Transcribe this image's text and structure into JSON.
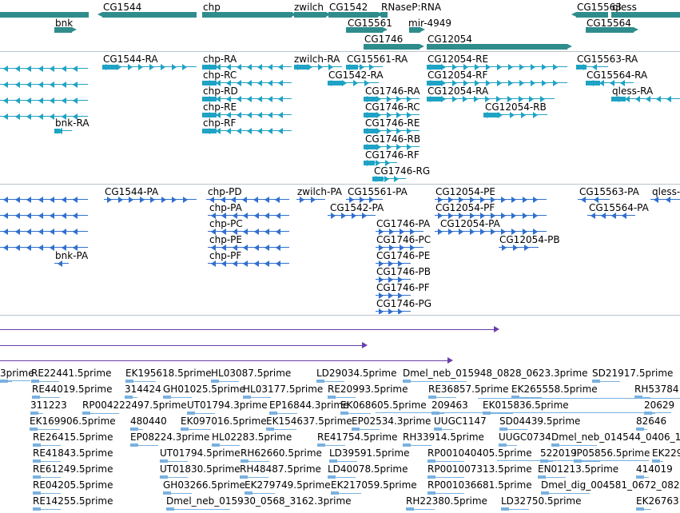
{
  "colors": {
    "gene": "#2f8c8c",
    "transcript": "#1ea3c4",
    "protein": "#2f6fd0",
    "purple": "#6a3fa8",
    "est": "#7ab1e0",
    "divider": "#b8c4cc"
  },
  "genes": [
    {
      "label": "bnk",
      "dir": "r"
    },
    {
      "label": "CG1544",
      "dir": "l"
    },
    {
      "label": "chp",
      "dir": "r"
    },
    {
      "label": "zwilch",
      "dir": "r"
    },
    {
      "label": "CG1542",
      "dir": "r"
    },
    {
      "label": "RNaseP:RNA",
      "dir": "l"
    },
    {
      "label": "CG15561",
      "dir": "r"
    },
    {
      "label": "mir-4949",
      "dir": "r"
    },
    {
      "label": "CG1746",
      "dir": "r"
    },
    {
      "label": "CG12054",
      "dir": "r"
    },
    {
      "label": "CG15563",
      "dir": "l"
    },
    {
      "label": "qless",
      "dir": "r"
    },
    {
      "label": "CG15564",
      "dir": "r"
    }
  ],
  "transcripts": [
    {
      "label": "CG1544-RA",
      "dir": "r"
    },
    {
      "label": "chp-RA",
      "dir": "l"
    },
    {
      "label": "zwilch-RA",
      "dir": "r"
    },
    {
      "label": "CG15561-RA",
      "dir": "r"
    },
    {
      "label": "CG12054-RE",
      "dir": "r"
    },
    {
      "label": "CG15563-RA",
      "dir": "l"
    },
    {
      "label": "chp-RC",
      "dir": "l"
    },
    {
      "label": "CG1542-RA",
      "dir": "r"
    },
    {
      "label": "CG12054-RF",
      "dir": "r"
    },
    {
      "label": "CG15564-RA",
      "dir": "l"
    },
    {
      "label": "chp-RD",
      "dir": "l"
    },
    {
      "label": "CG1746-RA",
      "dir": "r"
    },
    {
      "label": "CG12054-RA",
      "dir": "r"
    },
    {
      "label": "qless-RA",
      "dir": "l"
    },
    {
      "label": "chp-RE",
      "dir": "l"
    },
    {
      "label": "CG1746-RC",
      "dir": "r"
    },
    {
      "label": "CG12054-RB",
      "dir": "r"
    },
    {
      "label": "bnk-RA",
      "dir": "l"
    },
    {
      "label": "chp-RF",
      "dir": "l"
    },
    {
      "label": "CG1746-RE",
      "dir": "r"
    },
    {
      "label": "CG1746-RB",
      "dir": "r"
    },
    {
      "label": "CG1746-RF",
      "dir": "r"
    },
    {
      "label": "CG1746-RG",
      "dir": "r"
    }
  ],
  "proteins": [
    {
      "label": "CG1544-PA",
      "dir": "r"
    },
    {
      "label": "chp-PD",
      "dir": "l"
    },
    {
      "label": "zwilch-PA",
      "dir": "r"
    },
    {
      "label": "CG15561-PA",
      "dir": "r"
    },
    {
      "label": "CG12054-PE",
      "dir": "r"
    },
    {
      "label": "CG15563-PA",
      "dir": "l"
    },
    {
      "label": "qless-",
      "dir": "l"
    },
    {
      "label": "chp-PA",
      "dir": "l"
    },
    {
      "label": "CG1542-PA",
      "dir": "r"
    },
    {
      "label": "CG12054-PF",
      "dir": "r"
    },
    {
      "label": "CG15564-PA",
      "dir": "l"
    },
    {
      "label": "chp-PC",
      "dir": "l"
    },
    {
      "label": "CG1746-PA",
      "dir": "r"
    },
    {
      "label": "CG12054-PA",
      "dir": "r"
    },
    {
      "label": "chp-PE",
      "dir": "l"
    },
    {
      "label": "CG1746-PC",
      "dir": "r"
    },
    {
      "label": "CG12054-PB",
      "dir": "r"
    },
    {
      "label": "bnk-PA",
      "dir": "l"
    },
    {
      "label": "chp-PF",
      "dir": "l"
    },
    {
      "label": "CG1746-PE",
      "dir": "r"
    },
    {
      "label": "CG1746-PB",
      "dir": "r"
    },
    {
      "label": "CG1746-PF",
      "dir": "r"
    },
    {
      "label": "CG1746-PG",
      "dir": "r"
    }
  ],
  "ests": [
    "3prime",
    "RE22441.5prime",
    "EK195618.5prime",
    "HL03087.5prime",
    "LD29034.5prime",
    "Dmel_neb_015948_0828_0623.3prime",
    "SD21917.5prime",
    "RE44019.5prime",
    "314424",
    "GH01025.5prime",
    "HL03177.5prime",
    "RE20993.5prime",
    "RE36857.5prime",
    "EK265558.5prime",
    "RH53784",
    "311223",
    "RP004222497.5prime",
    "UT01794.3prime",
    "EP16844.3prime",
    "EK068605.5prime",
    "209463",
    "EK015836.5prime",
    "20629",
    "EK169906.5prime",
    "480440",
    "EK097016.5prime",
    "EK154637.5prime",
    "EP02534.3prime",
    "UUGC1147",
    "SD04439.5prime",
    "82646",
    "RE26415.5prime",
    "EP08224.3prime",
    "HL02283.5prime",
    "RE41754.5prime",
    "RH33914.5prime",
    "UUGC0734",
    "Dmel_neb_014544_0406_1",
    "RE41843.5prime",
    "UT01794.5prime",
    "RH62660.5prime",
    "LD39591.5prime",
    "RP001040405.5prime",
    "522019",
    "IP05856.5prime",
    "EK229",
    "RE61249.5prime",
    "UT01830.5prime",
    "RH48487.5prime",
    "LD40078.5prime",
    "RP001007313.5prime",
    "EN01213.5prime",
    "414019",
    "RE04205.5prime",
    "GH03266.5prime",
    "EK279749.5prime",
    "EK217059.5prime",
    "RP001036681.5prime",
    "Dmel_dig_004581_0672_082",
    "RE14255.5prime",
    "Dmel_neb_015930_0568_3162.3prime",
    "RH22380.5prime",
    "LD32750.5prime",
    "EK26763"
  ]
}
